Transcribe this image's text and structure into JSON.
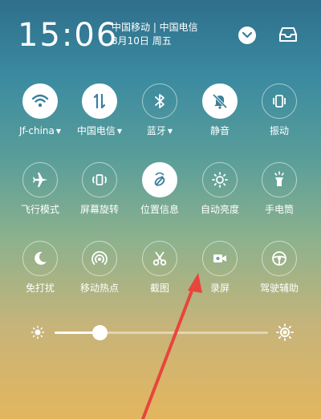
{
  "status": {
    "time": "15:06",
    "carriers": "中国移动 | 中国电信",
    "date": "8月10日 周五"
  },
  "tiles": [
    {
      "label": "Jf-china",
      "icon": "wifi-icon",
      "on": true,
      "caret": true
    },
    {
      "label": "中国电信",
      "icon": "mobile-data-icon",
      "on": true,
      "caret": true
    },
    {
      "label": "蓝牙",
      "icon": "bluetooth-icon",
      "on": false,
      "caret": true
    },
    {
      "label": "静音",
      "icon": "mute-icon",
      "on": true,
      "caret": false
    },
    {
      "label": "振动",
      "icon": "vibrate-icon",
      "on": false,
      "caret": false
    },
    {
      "label": "飞行模式",
      "icon": "airplane-icon",
      "on": false,
      "caret": false
    },
    {
      "label": "屏幕旋转",
      "icon": "rotation-icon",
      "on": false,
      "caret": false
    },
    {
      "label": "位置信息",
      "icon": "location-icon",
      "on": true,
      "caret": false
    },
    {
      "label": "自动亮度",
      "icon": "auto-brightness-icon",
      "on": false,
      "caret": false
    },
    {
      "label": "手电筒",
      "icon": "flashlight-icon",
      "on": false,
      "caret": false
    },
    {
      "label": "免打扰",
      "icon": "moon-icon",
      "on": false,
      "caret": false
    },
    {
      "label": "移动热点",
      "icon": "hotspot-icon",
      "on": false,
      "caret": false
    },
    {
      "label": "截图",
      "icon": "scissors-icon",
      "on": false,
      "caret": false
    },
    {
      "label": "录屏",
      "icon": "screen-record-icon",
      "on": false,
      "caret": false
    },
    {
      "label": "驾驶辅助",
      "icon": "steering-wheel-icon",
      "on": false,
      "caret": false
    }
  ],
  "brightness": {
    "level": 0.21
  },
  "colors": {
    "accent_on_icon": "#3a7f9c",
    "annotation_arrow": "#e8453c"
  }
}
